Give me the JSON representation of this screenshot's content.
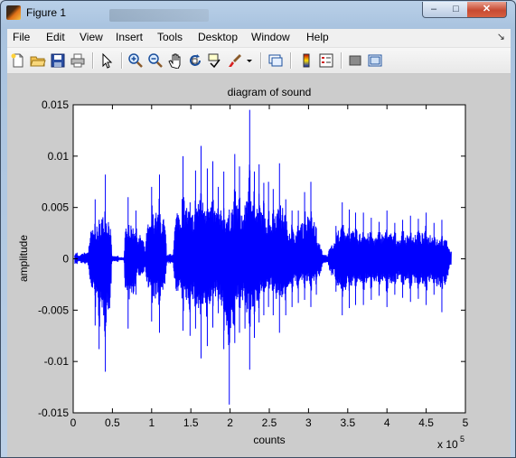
{
  "window": {
    "title": "Figure 1",
    "minimize_glyph": "‒",
    "maximize_glyph": "□",
    "close_glyph": "✕"
  },
  "menu": {
    "items": [
      "File",
      "Edit",
      "View",
      "Insert",
      "Tools",
      "Desktop",
      "Window",
      "Help"
    ],
    "dock_glyph": "↘"
  },
  "toolbar": {
    "buttons": [
      "new-figure-icon",
      "open-file-icon",
      "save-icon",
      "print-icon",
      "edit-plot-arrow-icon",
      "zoom-in-icon",
      "zoom-out-icon",
      "pan-hand-icon",
      "rotate-3d-icon",
      "data-cursor-icon",
      "brush-icon",
      "brush-dropdown-icon",
      "link-plot-icon",
      "insert-colorbar-icon",
      "insert-legend-icon",
      "hide-plot-tools-icon",
      "show-plot-tools-icon"
    ]
  },
  "chart_data": {
    "type": "line",
    "title": "diagram of sound",
    "xlabel": "counts",
    "ylabel": "amplitude",
    "x_exponent_label": "x 10",
    "x_exponent_power": "5",
    "xlim": [
      0,
      5
    ],
    "ylim": [
      -0.015,
      0.015
    ],
    "x_ticks": [
      "0",
      "0.5",
      "1",
      "1.5",
      "2",
      "2.5",
      "3",
      "3.5",
      "4",
      "4.5",
      "5"
    ],
    "y_ticks": [
      "0.015",
      "0.01",
      "0.005",
      "0",
      "-0.005",
      "-0.01",
      "-0.015"
    ],
    "grid": false,
    "line_color": "#0000ff",
    "series": [
      {
        "x": [
          0.05,
          0.1,
          0.2,
          0.28,
          0.33,
          0.41,
          0.49,
          0.57,
          0.65,
          0.7,
          0.8,
          0.92,
          1.0,
          1.1,
          1.19,
          1.28,
          1.4,
          1.49,
          1.56,
          1.63,
          1.71,
          1.78,
          1.85,
          1.92,
          1.99,
          2.06,
          2.12,
          2.19,
          2.25,
          2.31,
          2.37,
          2.43,
          2.49,
          2.55,
          2.63,
          2.71,
          2.79,
          2.87,
          2.95,
          3.03,
          3.1,
          3.17,
          3.25,
          3.35,
          3.43,
          3.52,
          3.6,
          3.7,
          3.8,
          3.9,
          4.0,
          4.1,
          4.2,
          4.3,
          4.4,
          4.5,
          4.6,
          4.7,
          4.8
        ],
        "ymax": [
          0.0006,
          0.0004,
          0.0012,
          0.0058,
          0.0038,
          0.0082,
          0.0005,
          0.0003,
          0.0002,
          0.006,
          0.0047,
          0.0003,
          0.007,
          0.0082,
          0.0003,
          0.0009,
          0.01,
          0.0055,
          0.0086,
          0.011,
          0.0088,
          0.0095,
          0.007,
          0.0085,
          0.0048,
          0.0102,
          0.009,
          0.0052,
          0.0145,
          0.0085,
          0.0092,
          0.0074,
          0.0075,
          0.0068,
          0.0093,
          0.0058,
          0.0047,
          0.0047,
          0.0065,
          0.0075,
          0.003,
          0.0008,
          0.0003,
          0.0032,
          0.0055,
          0.0048,
          0.0045,
          0.0045,
          0.004,
          0.0036,
          0.0047,
          0.0035,
          0.0038,
          0.0042,
          0.0039,
          0.0045,
          0.0035,
          0.0038,
          0.0007
        ],
        "ymin": [
          -0.0005,
          -0.0004,
          -0.001,
          -0.0065,
          -0.0088,
          -0.011,
          -0.0005,
          -0.0003,
          -0.0002,
          -0.0068,
          -0.0035,
          -0.0003,
          -0.0061,
          -0.0072,
          -0.0003,
          -0.0009,
          -0.007,
          -0.0075,
          -0.0068,
          -0.0097,
          -0.0085,
          -0.0067,
          -0.0053,
          -0.0088,
          -0.0142,
          -0.0082,
          -0.0072,
          -0.0068,
          -0.0108,
          -0.0077,
          -0.0062,
          -0.0055,
          -0.0047,
          -0.0055,
          -0.0072,
          -0.0055,
          -0.0047,
          -0.0043,
          -0.004,
          -0.0047,
          -0.0035,
          -0.0008,
          -0.0003,
          -0.0032,
          -0.0055,
          -0.0048,
          -0.0045,
          -0.0045,
          -0.004,
          -0.0036,
          -0.0047,
          -0.0035,
          -0.0038,
          -0.0042,
          -0.0039,
          -0.0045,
          -0.0035,
          -0.0052,
          -0.0006
        ]
      }
    ]
  }
}
